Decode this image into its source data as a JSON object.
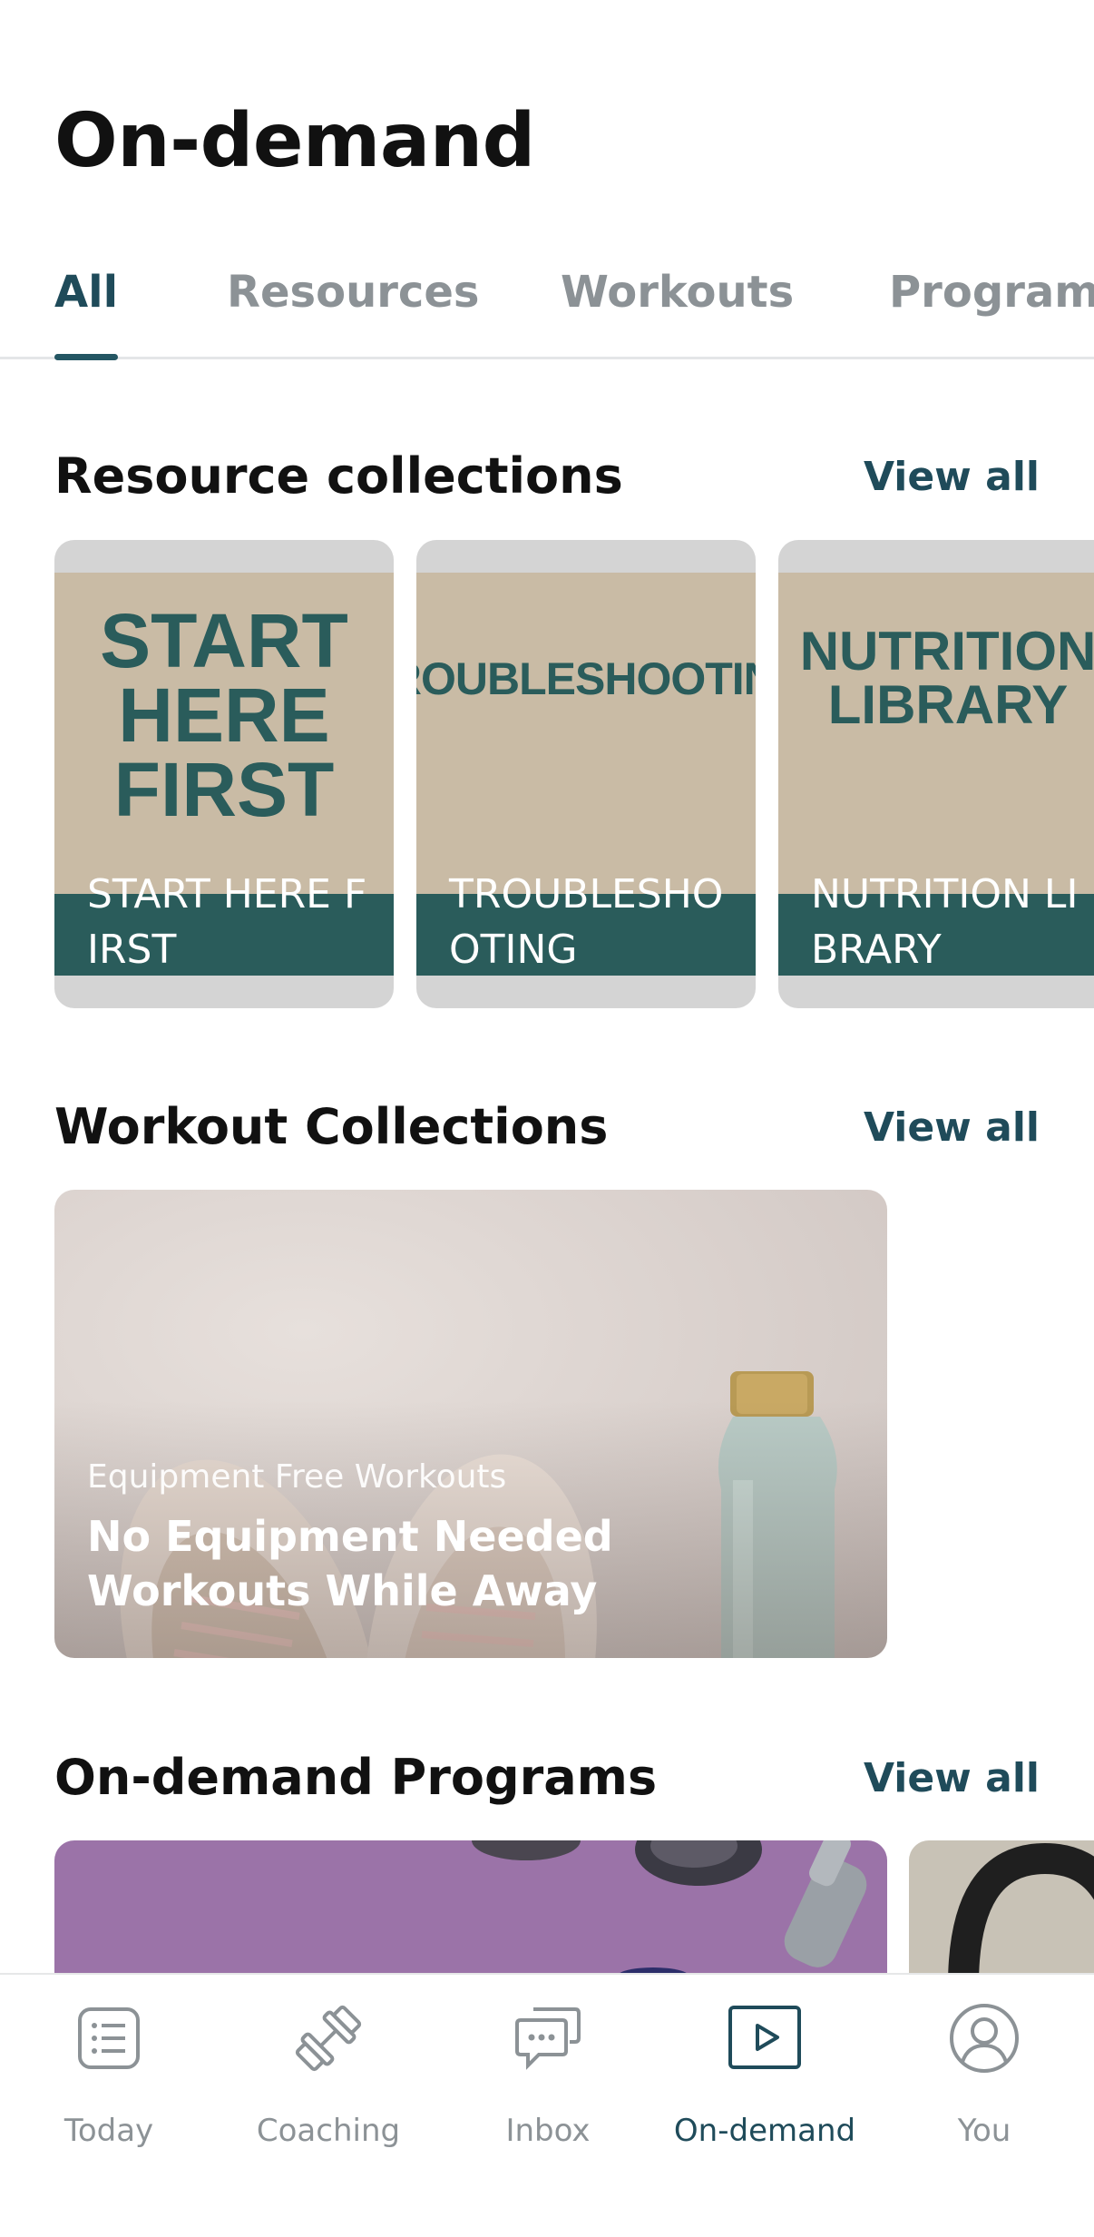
{
  "page_title": "On-demand",
  "tabs": [
    {
      "label": "All",
      "active": true
    },
    {
      "label": "Resources",
      "active": false
    },
    {
      "label": "Workouts",
      "active": false
    },
    {
      "label": "Programs",
      "active": false
    }
  ],
  "resource_collections": {
    "title": "Resource collections",
    "view_all": "View all",
    "cards": [
      {
        "art_text": "START HERE FIRST",
        "label": "START HERE FIRST"
      },
      {
        "art_text": "TROUBLESHOOTING",
        "label": "TROUBLESHOOTING"
      },
      {
        "art_text": "NUTRITION LIBRARY",
        "label": "NUTRITION LIBRARY"
      }
    ]
  },
  "workout_collections": {
    "title": "Workout Collections",
    "view_all": "View all",
    "card": {
      "subtitle": "Equipment Free Workouts",
      "name": "No Equipment Needed Workouts While Away"
    }
  },
  "programs": {
    "title": "On-demand Programs",
    "view_all": "View all"
  },
  "bottom_nav": [
    {
      "label": "Today",
      "icon": "list-icon",
      "active": false
    },
    {
      "label": "Coaching",
      "icon": "dumbbell-icon",
      "active": false
    },
    {
      "label": "Inbox",
      "icon": "chat-icon",
      "active": false
    },
    {
      "label": "On-demand",
      "icon": "play-icon",
      "active": true
    },
    {
      "label": "You",
      "icon": "person-icon",
      "active": false
    }
  ],
  "colors": {
    "accent": "#1f4b5a",
    "inactive": "#8c9296",
    "card_teal": "#2a5c5b",
    "card_beige": "#c9bba5"
  }
}
